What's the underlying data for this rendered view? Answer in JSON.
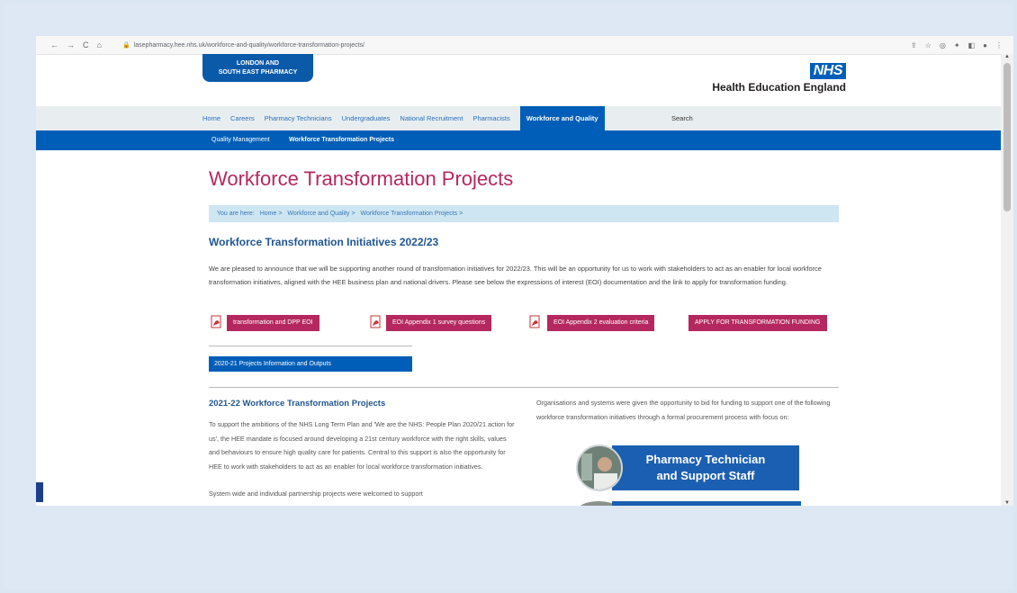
{
  "browser": {
    "url": "lasepharmacy.hee.nhs.uk/workforce-and-quality/workforce-transformation-projects/",
    "nav_back": "←",
    "nav_forward": "→",
    "nav_reload": "C",
    "nav_home": "⌂"
  },
  "header": {
    "lse_line1": "LONDON AND",
    "lse_line2": "SOUTH EAST PHARMACY",
    "nhs": "NHS",
    "org": "Health Education England"
  },
  "main_nav": {
    "items": [
      "Home",
      "Careers",
      "Pharmacy Technicians",
      "Undergraduates",
      "National Recruitment",
      "Pharmacists"
    ],
    "active": "Workforce and Quality",
    "search": "Search"
  },
  "sub_nav": {
    "items": [
      "Quality Management",
      "Workforce Transformation Projects"
    ]
  },
  "page": {
    "title": "Workforce Transformation Projects",
    "breadcrumb": [
      "You are here:",
      "Home >",
      "Workforce and Quality >",
      "Workforce Transformation Projects >"
    ],
    "heading": "Workforce Transformation Initiatives 2022/23",
    "intro": "We are pleased to announce that we will be supporting another round of transformation initiatives for 2022/23. This will be an opportunity for us to work with stakeholders to act as an enabler for local workforce transformation initiatives, aligned with the HEE business plan and national drivers. Please see below the expressions of interest (EOI) documentation and the link to apply for transformation funding.",
    "buttons": {
      "eoi": "transformation and DPP EOI",
      "appendix1": "EOI Appendix 1 survey questions",
      "appendix2": "EOI Appendix 2 evaluation criteria",
      "apply": "APPLY FOR TRANSFORMATION FUNDING",
      "projects": "2020-21 Projects Information and Outputs"
    },
    "section_heading": "2021-22 Workforce Transformation Projects",
    "section_text": "To support the ambitions of the NHS Long Term Plan and 'We are the NHS: People Plan 2020/21 action for us', the HEE mandate is focused around developing a 21st century workforce with the right skills, values and behaviours to ensure high quality care for patients. Central to this support is also the opportunity for HEE to work with stakeholders to act as an enabler for local workforce transformation initiatives.",
    "section_more": "System wide and individual partnership projects were welcomed to support",
    "right_text": "Organisations and systems were given the opportunity to bid for funding to support one of the following workforce transformation initiatives through a formal procurement process with focus on:",
    "banner_line1": "Pharmacy Technician",
    "banner_line2": "and Support Staff"
  },
  "colors": {
    "nhs_blue": "#005eb8",
    "title_pink": "#b5285f",
    "heading_blue": "#21568f"
  }
}
